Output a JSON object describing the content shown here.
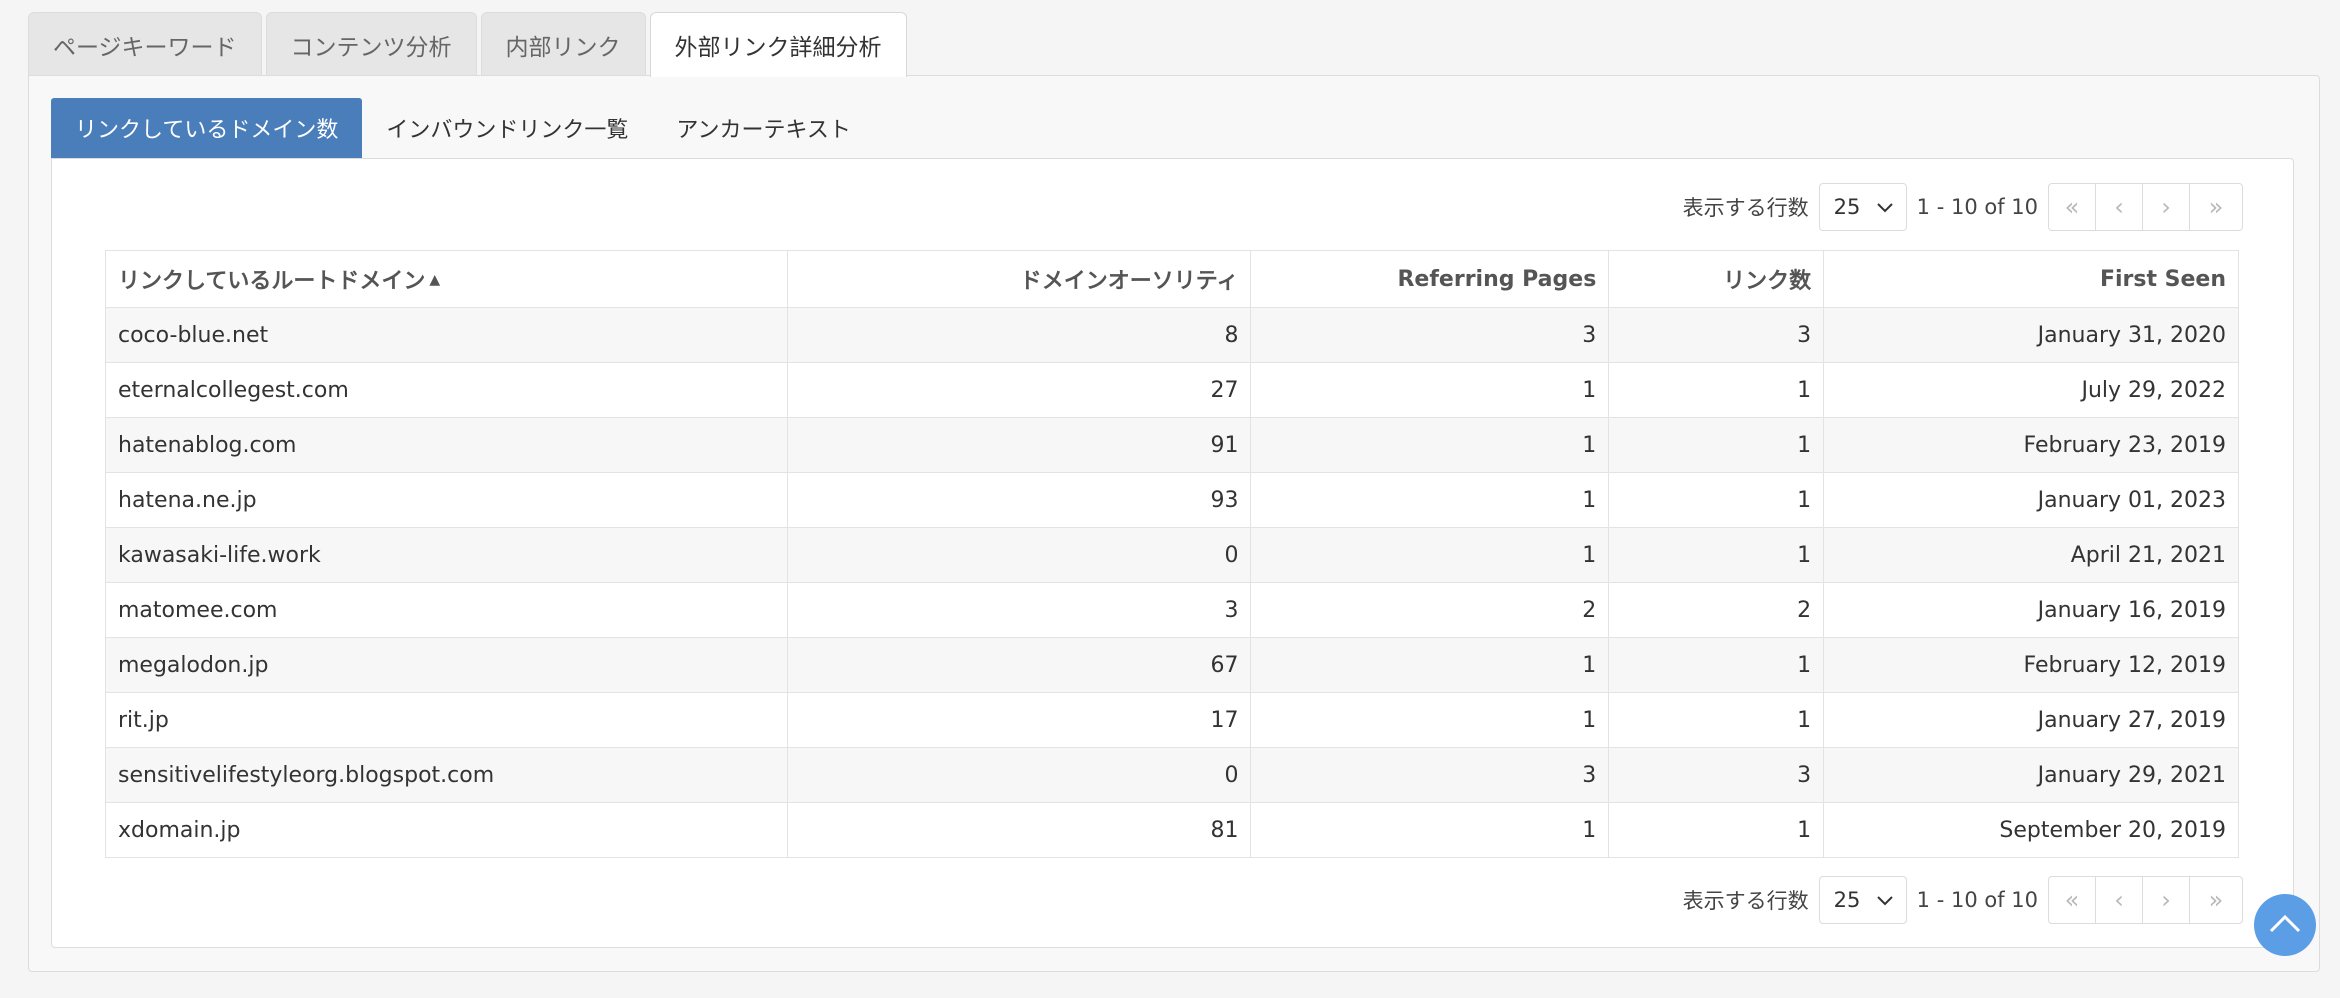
{
  "main_tabs": [
    {
      "label": "ページキーワード"
    },
    {
      "label": "コンテンツ分析"
    },
    {
      "label": "内部リンク"
    },
    {
      "label": "外部リンク詳細分析"
    }
  ],
  "sub_tabs": [
    {
      "label": "リンクしているドメイン数"
    },
    {
      "label": "インバウンドリンク一覧"
    },
    {
      "label": "アンカーテキスト"
    }
  ],
  "pager": {
    "rows_label": "表示する行数",
    "rows_value": "25",
    "range": "1 - 10 of 10"
  },
  "table": {
    "headers": [
      "リンクしているルートドメイン",
      "ドメインオーソリティ",
      "Referring Pages",
      "リンク数",
      "First Seen"
    ],
    "rows": [
      [
        "coco-blue.net",
        "8",
        "3",
        "3",
        "January 31, 2020"
      ],
      [
        "eternalcollegest.com",
        "27",
        "1",
        "1",
        "July 29, 2022"
      ],
      [
        "hatenablog.com",
        "91",
        "1",
        "1",
        "February 23, 2019"
      ],
      [
        "hatena.ne.jp",
        "93",
        "1",
        "1",
        "January 01, 2023"
      ],
      [
        "kawasaki-life.work",
        "0",
        "1",
        "1",
        "April 21, 2021"
      ],
      [
        "matomee.com",
        "3",
        "2",
        "2",
        "January 16, 2019"
      ],
      [
        "megalodon.jp",
        "67",
        "1",
        "1",
        "February 12, 2019"
      ],
      [
        "rit.jp",
        "17",
        "1",
        "1",
        "January 27, 2019"
      ],
      [
        "sensitivelifestyleorg.blogspot.com",
        "0",
        "3",
        "3",
        "January 29, 2021"
      ],
      [
        "xdomain.jp",
        "81",
        "1",
        "1",
        "September 20, 2019"
      ]
    ]
  },
  "colors": {
    "active_subtab": "#4a7ebb",
    "scroll_top_button": "#5c9ee6"
  }
}
